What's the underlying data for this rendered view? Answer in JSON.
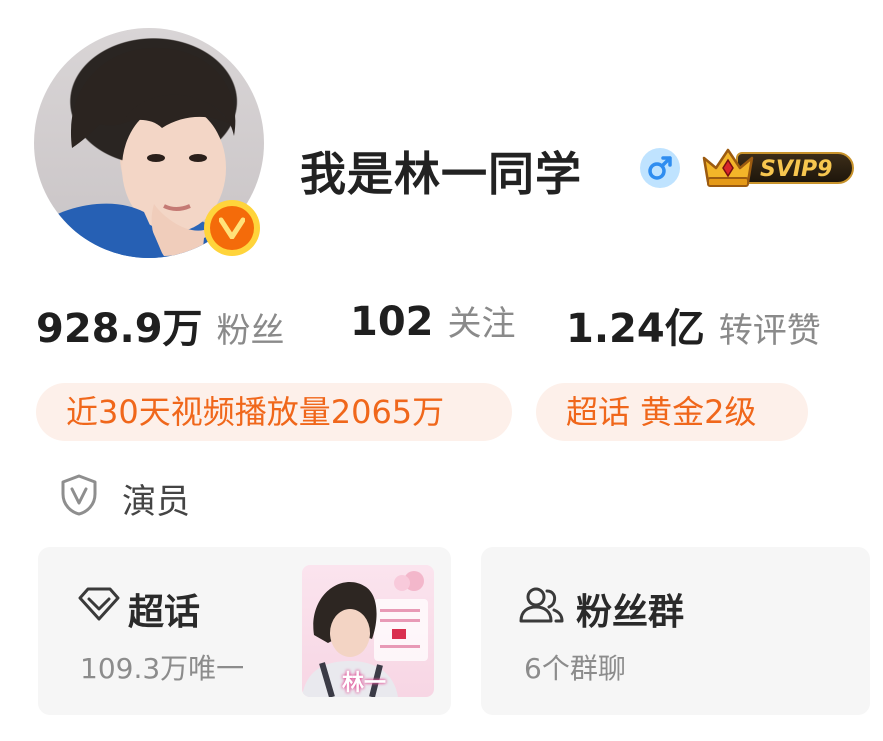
{
  "profile": {
    "name": "我是林一同学",
    "gender_icon": "male-symbol-icon",
    "vip_label": "SVIP9"
  },
  "stats": [
    {
      "value": "928.9万",
      "label": "粉丝"
    },
    {
      "value": "102",
      "label": "关注"
    },
    {
      "value": "1.24亿",
      "label": "转评赞"
    }
  ],
  "tags": [
    "近30天视频播放量2065万",
    "超话 黄金2级"
  ],
  "role": "演员",
  "cards": {
    "supertopic": {
      "title": "超话",
      "subtitle": "109.3万唯一",
      "thumb_text": "林一"
    },
    "fangroup": {
      "title": "粉丝群",
      "subtitle": "6个群聊"
    }
  },
  "colors": {
    "accent_orange": "#f0671b",
    "tag_background": "#fdf0ea",
    "verify_badge": "#f46b0a",
    "gender_badge": "#bfe3ff"
  }
}
